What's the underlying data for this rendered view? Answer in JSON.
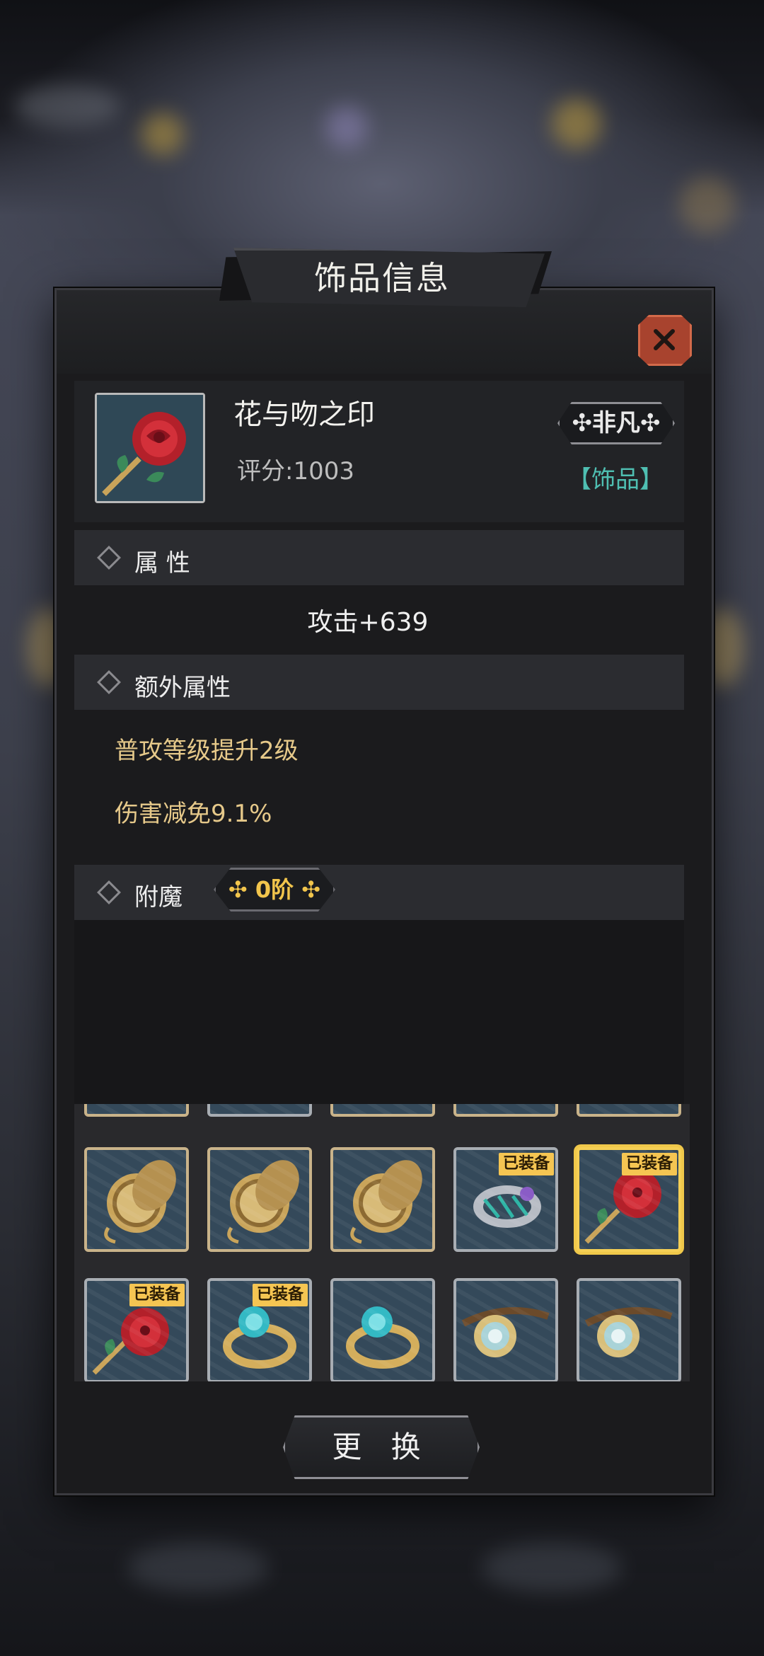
{
  "dialog": {
    "title": "饰品信息"
  },
  "item": {
    "name": "花与吻之印",
    "score_label": "评分:1003",
    "rarity": "非凡",
    "type": "【饰品】",
    "icon": "rose-icon"
  },
  "sections": {
    "attributes": {
      "title": "属 性",
      "lines": [
        "攻击+639"
      ]
    },
    "extra": {
      "title": "额外属性",
      "lines": [
        "普攻等级提升2级",
        "伤害减免9.1%"
      ]
    },
    "enchant": {
      "title": "附魔",
      "tier": "0阶"
    }
  },
  "inventory": {
    "equipped_tag": "已装备",
    "row1": [
      {
        "icon": "pocket-watch-icon",
        "equipped": false
      },
      {
        "icon": "pocket-watch-icon",
        "equipped": false
      },
      {
        "icon": "pocket-watch-icon",
        "equipped": false
      },
      {
        "icon": "bracer-icon",
        "equipped": true
      },
      {
        "icon": "rose-icon",
        "equipped": true,
        "selected": true
      }
    ],
    "row2": [
      {
        "icon": "rose-icon",
        "equipped": true
      },
      {
        "icon": "gem-ring-icon",
        "equipped": true
      },
      {
        "icon": "gem-ring-icon",
        "equipped": false
      },
      {
        "icon": "goggles-icon",
        "equipped": false
      },
      {
        "icon": "goggles-icon",
        "equipped": false
      }
    ]
  },
  "actions": {
    "swap_label": "更 换"
  },
  "colors": {
    "accent_gold": "#f2c54c",
    "type_teal": "#4fbfb2",
    "close_red": "#a8432e"
  }
}
